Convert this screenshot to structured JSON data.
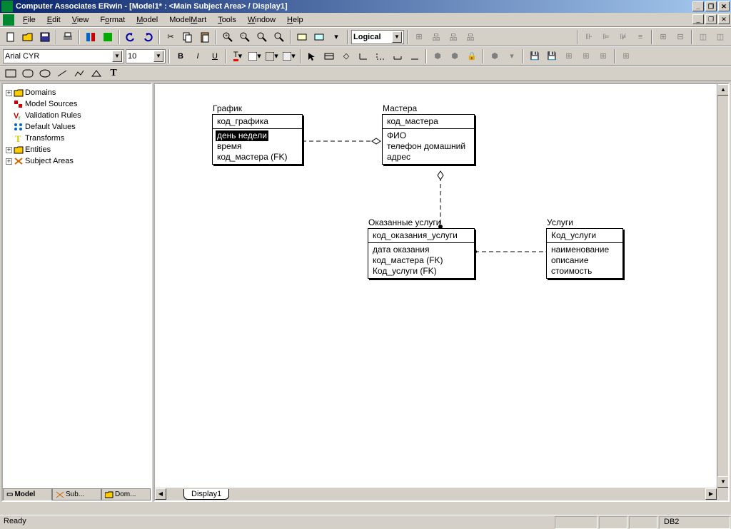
{
  "app": {
    "title": "Computer Associates ERwin - [Model1* : <Main Subject Area> / Display1]"
  },
  "menu": {
    "file": "File",
    "edit": "Edit",
    "view": "View",
    "format": "Format",
    "model": "Model",
    "modelmart": "ModelMart",
    "tools": "Tools",
    "window": "Window",
    "help": "Help"
  },
  "toolbar": {
    "view_combo": "Logical",
    "font_name": "Arial CYR",
    "font_size": "10"
  },
  "tree": {
    "items": [
      {
        "label": "Domains",
        "expander": "+",
        "icon": "folder"
      },
      {
        "label": "Model Sources",
        "expander": "",
        "icon": "model-sources"
      },
      {
        "label": "Validation Rules",
        "expander": "",
        "icon": "validation"
      },
      {
        "label": "Default Values",
        "expander": "",
        "icon": "defaults"
      },
      {
        "label": "Transforms",
        "expander": "",
        "icon": "transforms"
      },
      {
        "label": "Entities",
        "expander": "+",
        "icon": "folder"
      },
      {
        "label": "Subject Areas",
        "expander": "+",
        "icon": "subject"
      }
    ],
    "tabs": {
      "model": "Model",
      "sub": "Sub...",
      "dom": "Dom..."
    }
  },
  "entities": {
    "grafik": {
      "title": "График",
      "pk": [
        "код_графика"
      ],
      "attrs": [
        "день недели",
        "время",
        "код_мастера (FK)"
      ]
    },
    "mastera": {
      "title": "Мастера",
      "pk": [
        "код_мастера"
      ],
      "attrs": [
        "ФИО",
        "телефон домашний",
        "адрес"
      ]
    },
    "okazannye": {
      "title": "Оказанные услуги",
      "pk": [
        "код_оказания_услуги"
      ],
      "attrs": [
        "дата оказания",
        "код_мастера (FK)",
        "Код_услуги (FK)"
      ]
    },
    "uslugi": {
      "title": "Услуги",
      "pk": [
        "Код_услуги"
      ],
      "attrs": [
        "наименование",
        "описание",
        "стоимость"
      ]
    }
  },
  "canvas": {
    "tab": "Display1"
  },
  "status": {
    "ready": "Ready",
    "db": "DB2"
  }
}
